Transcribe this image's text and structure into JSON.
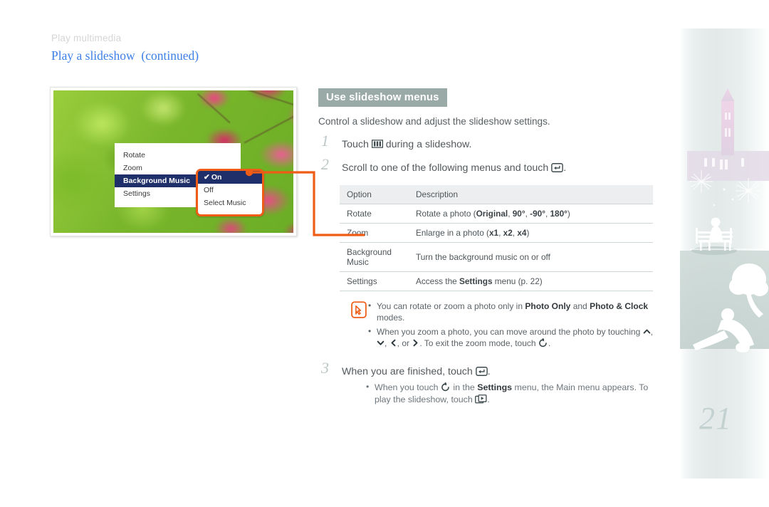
{
  "header": {
    "kicker": "Play multimedia",
    "title": "Play a slideshow  (continued)"
  },
  "colors": {
    "accent_orange": "#ee5c16",
    "heading_blue": "#3d7fe8",
    "section_bg": "#9aaaa6",
    "menu_select": "#1f2f69"
  },
  "illustration": {
    "name": "camera-slideshow-menu-screenshot",
    "menu_items": [
      {
        "label": "Rotate",
        "selected": false
      },
      {
        "label": "Zoom",
        "selected": false
      },
      {
        "label": "Background Music",
        "selected": true
      },
      {
        "label": "Settings",
        "selected": false
      }
    ],
    "submenu_items": [
      {
        "label": "On",
        "selected": true,
        "check": "✔"
      },
      {
        "label": "Off",
        "selected": false
      },
      {
        "label": "Select Music",
        "selected": false
      }
    ]
  },
  "section": {
    "heading": "Use slideshow menus",
    "lead": "Control a slideshow and adjust the slideshow settings."
  },
  "steps": [
    {
      "num": "1",
      "text_before": "Touch ",
      "icon": "menu-icon",
      "text_after": " during a slideshow."
    },
    {
      "num": "2",
      "text_before": "Scroll to one of the following menus and touch ",
      "icon": "enter-icon",
      "text_after": "."
    },
    {
      "num": "3",
      "text_before": "When you are finished, touch ",
      "icon": "enter-icon",
      "text_after": "."
    }
  ],
  "table": {
    "columns": [
      "Option",
      "Description"
    ],
    "rows": [
      {
        "option": "Rotate",
        "desc_parts": [
          {
            "t": "Rotate a photo (",
            "b": false
          },
          {
            "t": "Original",
            "b": true
          },
          {
            "t": ", ",
            "b": false
          },
          {
            "t": "90°",
            "b": true
          },
          {
            "t": ", ",
            "b": false
          },
          {
            "t": "-90°",
            "b": true
          },
          {
            "t": ", ",
            "b": false
          },
          {
            "t": "180°",
            "b": true
          },
          {
            "t": ")",
            "b": false
          }
        ]
      },
      {
        "option": "Zoom",
        "desc_parts": [
          {
            "t": "Enlarge in a photo (",
            "b": false
          },
          {
            "t": "x1",
            "b": true
          },
          {
            "t": ", ",
            "b": false
          },
          {
            "t": "x2",
            "b": true
          },
          {
            "t": ", ",
            "b": false
          },
          {
            "t": "x4",
            "b": true
          },
          {
            "t": ")",
            "b": false
          }
        ]
      },
      {
        "option": "Background Music",
        "desc_parts": [
          {
            "t": "Turn the background music on or off",
            "b": false
          }
        ]
      },
      {
        "option": "Settings",
        "desc_parts": [
          {
            "t": "Access the ",
            "b": false
          },
          {
            "t": "Settings",
            "b": true
          },
          {
            "t": " menu (p. 22)",
            "b": false
          }
        ]
      }
    ]
  },
  "note": {
    "icon": "note-pen-icon",
    "bullets": [
      [
        {
          "t": "You can rotate or zoom a photo only in ",
          "b": false
        },
        {
          "t": "Photo Only",
          "b": true
        },
        {
          "t": " and ",
          "b": false
        },
        {
          "t": "Photo & Clock",
          "b": true
        },
        {
          "t": " modes.",
          "b": false
        }
      ],
      [
        {
          "t": "When you zoom a photo, you can move around the photo by touching ",
          "b": false
        },
        {
          "t": "chevron-up-icon",
          "icon": true
        },
        {
          "t": ", ",
          "b": false
        },
        {
          "t": "chevron-down-icon",
          "icon": true
        },
        {
          "t": ", ",
          "b": false
        },
        {
          "t": "chevron-left-icon",
          "icon": true
        },
        {
          "t": ", or ",
          "b": false
        },
        {
          "t": "chevron-right-icon",
          "icon": true
        },
        {
          "t": ". To exit the zoom mode, touch ",
          "b": false
        },
        {
          "t": "back-icon",
          "icon": true
        },
        {
          "t": ".",
          "b": false
        }
      ]
    ]
  },
  "step3_note": [
    {
      "t": "When you touch ",
      "b": false
    },
    {
      "t": "back-icon",
      "icon": true
    },
    {
      "t": " in the ",
      "b": false
    },
    {
      "t": "Settings",
      "b": true
    },
    {
      "t": " menu, the Main menu appears. To play the slideshow, touch ",
      "b": false
    },
    {
      "t": "play-slideshow-icon",
      "icon": true
    },
    {
      "t": ".",
      "b": false
    }
  ],
  "footer": {
    "page_number": "21"
  }
}
